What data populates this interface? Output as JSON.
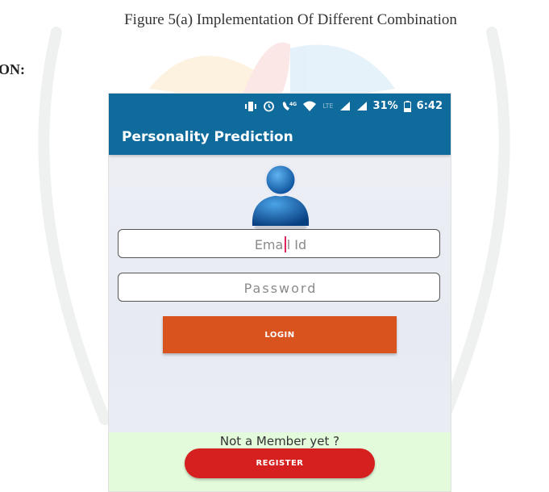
{
  "document": {
    "caption": "Figure 5(a) Implementation Of Different Combination",
    "heading_fragment": "ON:"
  },
  "status_bar": {
    "network": "4G",
    "lte": "LTE",
    "battery": "31%",
    "time": "6:42"
  },
  "app": {
    "title": "Personality Prediction"
  },
  "login_form": {
    "email_placeholder": "Email Id",
    "password_placeholder": "Password",
    "login_label": "LOGIN"
  },
  "footer": {
    "member_text": "Not a Member yet ?",
    "register_label": "REGISTER"
  },
  "colors": {
    "app_bar": "#0f6b9c",
    "login_button": "#d9531e",
    "register_button": "#d61f1f",
    "footer_bg": "#e3fbda"
  },
  "icons": [
    "vibrate-icon",
    "alarm-icon",
    "wifi-calling-icon",
    "wifi-icon",
    "signal-icon",
    "battery-icon",
    "user-avatar-icon"
  ]
}
